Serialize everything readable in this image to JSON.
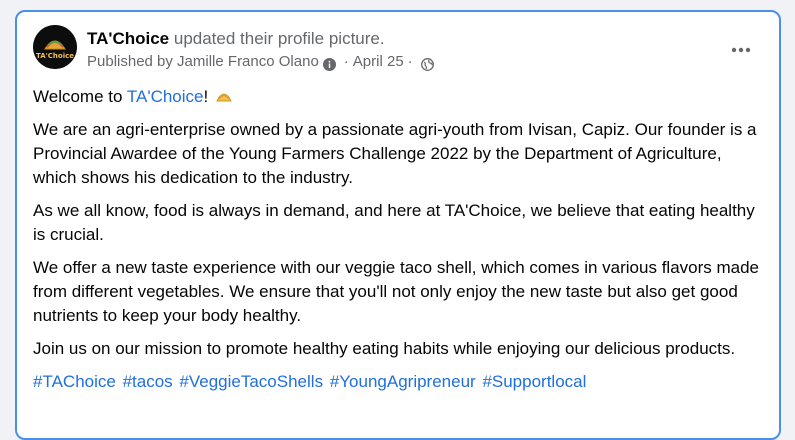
{
  "post": {
    "page_name": "TA'Choice",
    "action": "updated their profile picture.",
    "published_by": "Published by Jamille Franco Olano",
    "date": "April 25",
    "separator": "·",
    "avatar_logo_text": "TA'Choice",
    "icons": {
      "more": "more-horizontal-icon",
      "info": "info-icon",
      "audience": "globe-icon",
      "emoji": "taco-emoji-icon"
    },
    "colors": {
      "link": "#216fdb",
      "border": "#4a8fe8",
      "muted": "#65676b"
    },
    "welcome_prefix": "Welcome to ",
    "welcome_link": "TA'Choice",
    "welcome_suffix": "!",
    "paragraphs": [
      "We are an agri-enterprise owned by a passionate agri-youth from Ivisan, Capiz. Our founder is a Provincial Awardee of the Young Farmers Challenge 2022 by the Department of Agriculture, which shows his dedication to the industry.",
      "As we all know, food is always in demand, and here at TA'Choice, we believe that eating healthy is crucial.",
      "We offer a new taste experience with our veggie taco shell, which comes in various flavors made from different vegetables. We ensure that you'll not only enjoy the new taste but also get good nutrients to keep your body healthy.",
      "Join us on our mission to promote healthy eating habits while enjoying our delicious products."
    ],
    "hashtags": [
      "#TAChoice",
      "#tacos",
      "#VeggieTacoShells",
      "#YoungAgripreneur",
      "#Supportlocal"
    ]
  }
}
